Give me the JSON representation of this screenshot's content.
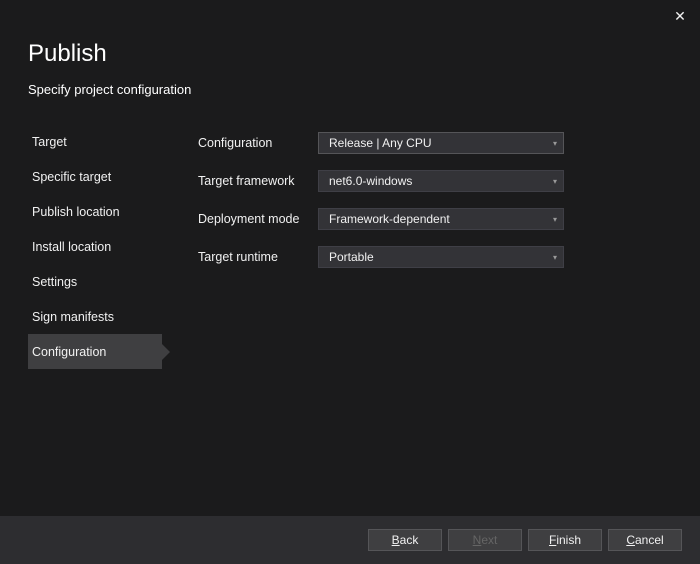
{
  "window": {
    "title": "Publish",
    "subtitle": "Specify project configuration"
  },
  "sidebar": {
    "items": [
      {
        "label": "Target"
      },
      {
        "label": "Specific target"
      },
      {
        "label": "Publish location"
      },
      {
        "label": "Install location"
      },
      {
        "label": "Settings"
      },
      {
        "label": "Sign manifests"
      },
      {
        "label": "Configuration"
      }
    ],
    "active_index": 6
  },
  "form": {
    "fields": [
      {
        "label": "Configuration",
        "value": "Release | Any CPU",
        "highlighted": true
      },
      {
        "label": "Target framework",
        "value": "net6.0-windows",
        "highlighted": false
      },
      {
        "label": "Deployment mode",
        "value": "Framework-dependent",
        "highlighted": false
      },
      {
        "label": "Target runtime",
        "value": "Portable",
        "highlighted": false
      }
    ]
  },
  "footer": {
    "back": {
      "pre": "",
      "u": "B",
      "post": "ack",
      "disabled": false
    },
    "next": {
      "pre": "",
      "u": "N",
      "post": "ext",
      "disabled": true
    },
    "finish": {
      "pre": "",
      "u": "F",
      "post": "inish",
      "disabled": false
    },
    "cancel": {
      "pre": "",
      "u": "C",
      "post": "ancel",
      "disabled": false
    }
  }
}
